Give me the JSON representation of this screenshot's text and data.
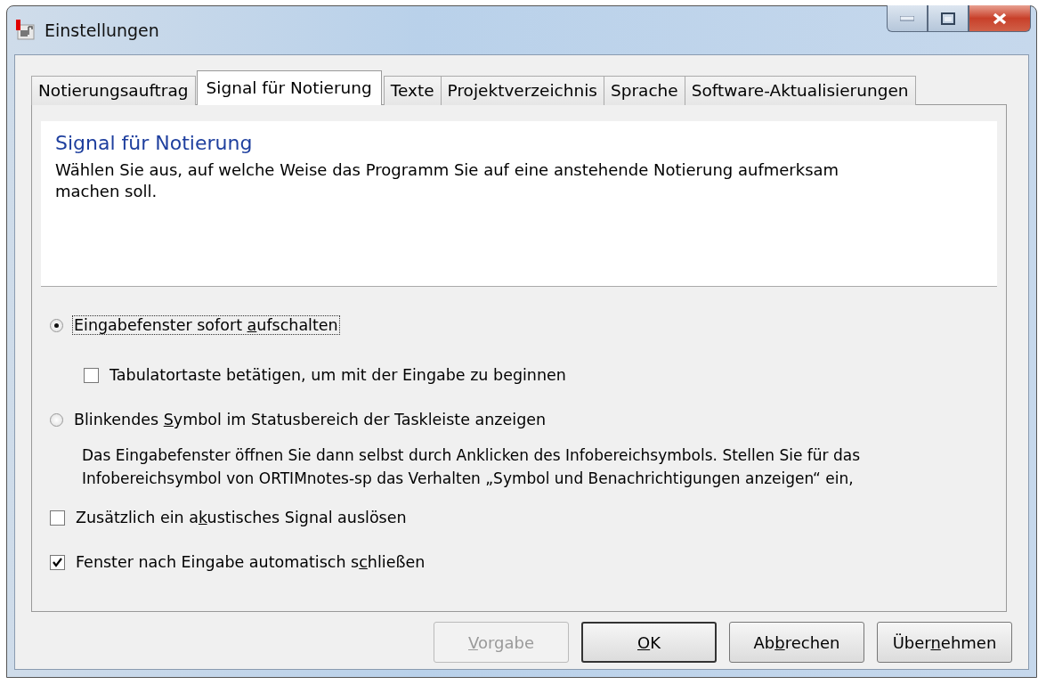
{
  "window": {
    "title": "Einstellungen"
  },
  "tabs": [
    {
      "label": "Notierungsauftrag",
      "selected": false
    },
    {
      "label": "Signal für Notierung",
      "selected": true
    },
    {
      "label": "Texte",
      "selected": false
    },
    {
      "label": "Projektverzeichnis",
      "selected": false
    },
    {
      "label": "Sprache",
      "selected": false
    },
    {
      "label": "Software-Aktualisierungen",
      "selected": false
    }
  ],
  "header": {
    "title": "Signal für Notierung",
    "description": "Wählen Sie aus, auf welche Weise das Programm Sie auf eine anstehende Notierung aufmerksam machen soll."
  },
  "options": [
    {
      "kind": "radio",
      "label_parts": [
        {
          "text": "Eingabefenster sofort ",
          "underline": false
        },
        {
          "text": "a",
          "underline": true
        },
        {
          "text": "ufschalten",
          "underline": false
        }
      ],
      "selected": true,
      "focused": true
    },
    {
      "kind": "subcheck",
      "label_parts": [
        {
          "text": "Tabulatortaste betätigen, um mit der Eingabe zu beginnen",
          "underline": false
        }
      ],
      "checked": false
    },
    {
      "kind": "radio",
      "label_parts": [
        {
          "text": "Blinkendes ",
          "underline": false
        },
        {
          "text": "S",
          "underline": true
        },
        {
          "text": "ymbol im Statusbereich der Taskleiste anzeigen",
          "underline": false
        }
      ],
      "selected": false,
      "focused": false
    },
    {
      "kind": "note",
      "text": "Das Eingabefenster öffnen Sie dann selbst durch Anklicken des Infobereichsymbols. Stellen Sie für das Infobereichsymbol von ORTIMnotes-sp das Verhalten „Symbol und Benachrichtigungen anzeigen“ ein,"
    },
    {
      "kind": "check",
      "label_parts": [
        {
          "text": "Zusätzlich ein a",
          "underline": false
        },
        {
          "text": "k",
          "underline": true
        },
        {
          "text": "ustisches Signal auslösen",
          "underline": false
        }
      ],
      "checked": false
    },
    {
      "kind": "check",
      "label_parts": [
        {
          "text": "Fenster nach Eingabe automatisch s",
          "underline": false
        },
        {
          "text": "c",
          "underline": true
        },
        {
          "text": "hließen",
          "underline": false
        }
      ],
      "checked": true
    }
  ],
  "buttons": [
    {
      "label_parts": [
        {
          "text": "V",
          "underline": true
        },
        {
          "text": "orgabe",
          "underline": false
        }
      ],
      "disabled": true,
      "default": false
    },
    {
      "label_parts": [
        {
          "text": "O",
          "underline": true
        },
        {
          "text": "K",
          "underline": false
        }
      ],
      "disabled": false,
      "default": true
    },
    {
      "label_parts": [
        {
          "text": "Ab",
          "underline": false
        },
        {
          "text": "b",
          "underline": true
        },
        {
          "text": "rechen",
          "underline": false
        }
      ],
      "disabled": false,
      "default": false
    },
    {
      "label_parts": [
        {
          "text": "Über",
          "underline": false
        },
        {
          "text": "n",
          "underline": true
        },
        {
          "text": "ehmen",
          "underline": false
        }
      ],
      "disabled": false,
      "default": false
    }
  ]
}
